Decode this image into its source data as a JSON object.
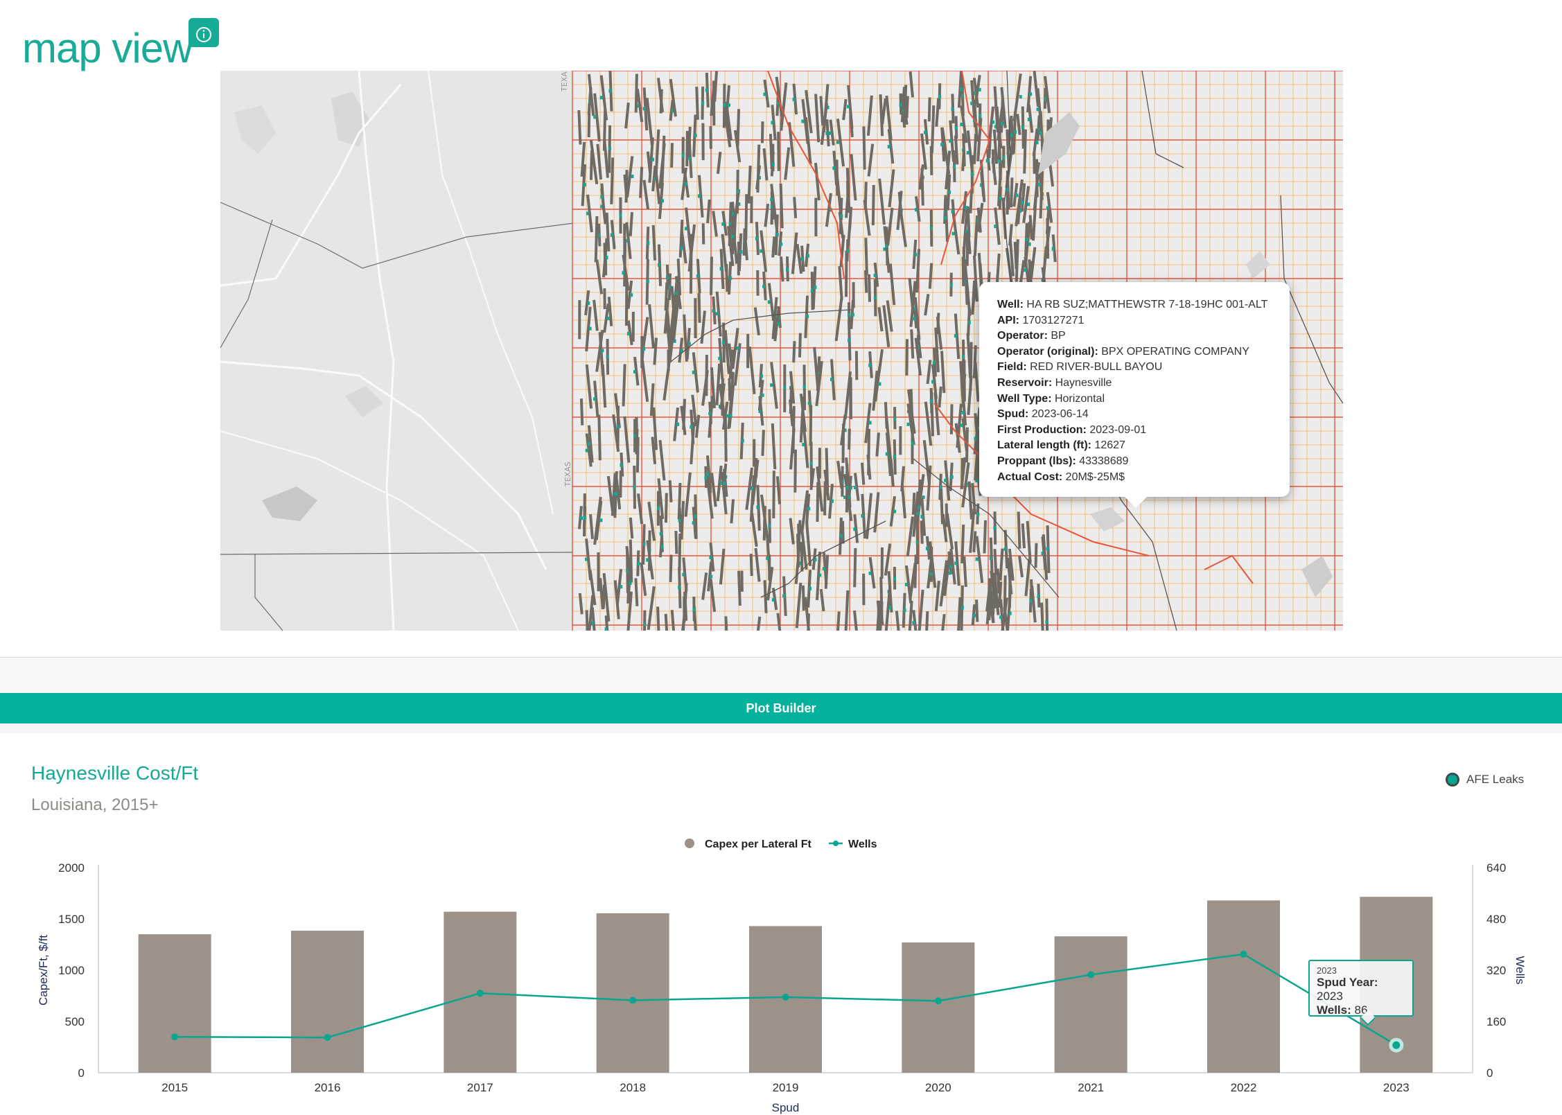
{
  "header": {
    "title": "map view",
    "info_icon": "info-circle-icon"
  },
  "map": {
    "state_label": "TEXAS",
    "state_label_vertical": "TEXAS",
    "popup": {
      "rows": [
        {
          "label": "Well:",
          "value": "HA RB SUZ;MATTHEWSTR 7-18-19HC 001-ALT"
        },
        {
          "label": "API:",
          "value": "1703127271"
        },
        {
          "label": "Operator:",
          "value": "BP"
        },
        {
          "label": "Operator (original):",
          "value": "BPX OPERATING COMPANY"
        },
        {
          "label": "Field:",
          "value": "RED RIVER-BULL BAYOU"
        },
        {
          "label": "Reservoir:",
          "value": "Haynesville"
        },
        {
          "label": "Well Type:",
          "value": "Horizontal"
        },
        {
          "label": "Spud:",
          "value": "2023-06-14"
        },
        {
          "label": "First Production:",
          "value": "2023-09-01"
        },
        {
          "label": "Lateral length (ft):",
          "value": "12627"
        },
        {
          "label": "Proppant (lbs):",
          "value": "43338689"
        },
        {
          "label": "Actual Cost:",
          "value": "20M$-25M$"
        }
      ]
    },
    "colors": {
      "grid_minor": "#f5b35a",
      "grid_major": "#e8553b",
      "wells": "#6f6a63",
      "well_accent": "#1aa592",
      "base": "#e8e8e8"
    }
  },
  "plot_builder": {
    "label": "Plot Builder"
  },
  "chart_section": {
    "title": "Haynesville Cost/Ft",
    "subtitle": "Louisiana, 2015+",
    "afe_legend_label": "AFE Leaks"
  },
  "chart_data": {
    "type": "bar",
    "categories": [
      "2015",
      "2016",
      "2017",
      "2018",
      "2019",
      "2020",
      "2021",
      "2022",
      "2023"
    ],
    "series": [
      {
        "name": "Capex per Lateral Ft",
        "type": "bar",
        "axis": "left",
        "color": "#9d928a",
        "values": [
          1350,
          1385,
          1570,
          1555,
          1430,
          1270,
          1330,
          1680,
          1715
        ]
      },
      {
        "name": "Wells",
        "type": "line",
        "axis": "right",
        "color": "#0aa58f",
        "values": [
          112,
          110,
          248,
          226,
          236,
          224,
          306,
          370,
          86
        ]
      }
    ],
    "xlabel": "Spud",
    "ylabel": "Capex/Ft, $/ft",
    "y2label": "Wells",
    "ylim": [
      0,
      2000
    ],
    "y2lim": [
      0,
      640
    ],
    "yticks": [
      "0",
      "500",
      "1000",
      "1500",
      "2000"
    ],
    "y2ticks": [
      "0",
      "160",
      "320",
      "480",
      "640"
    ],
    "legend_position": "top-center",
    "grid": false,
    "tooltip": {
      "header": "2023",
      "label1": "Spud Year:",
      "value1": "2023",
      "label2": "Wells:",
      "value2": "86"
    }
  }
}
